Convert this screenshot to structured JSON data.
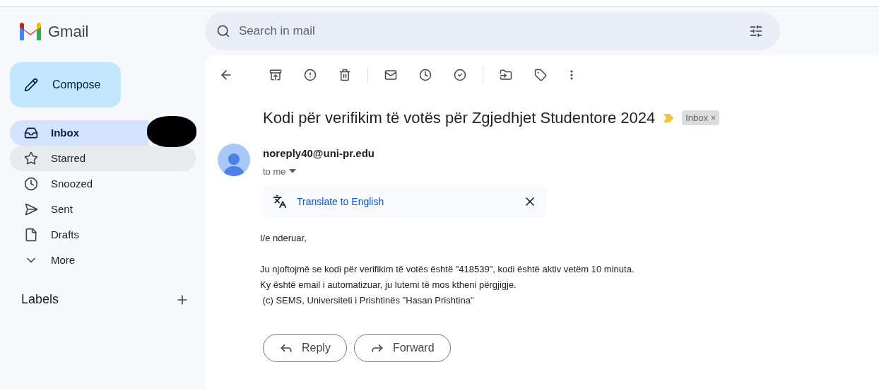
{
  "app": {
    "name": "Gmail"
  },
  "search": {
    "placeholder": "Search in mail"
  },
  "compose": {
    "label": "Compose"
  },
  "sidebar": {
    "items": [
      {
        "label": "Inbox",
        "selected": true,
        "hovered": false
      },
      {
        "label": "Starred",
        "selected": false,
        "hovered": true
      },
      {
        "label": "Snoozed",
        "selected": false,
        "hovered": false
      },
      {
        "label": "Sent",
        "selected": false,
        "hovered": false
      },
      {
        "label": "Drafts",
        "selected": false,
        "hovered": false
      },
      {
        "label": "More",
        "selected": false,
        "hovered": false
      }
    ],
    "labels_heading": "Labels"
  },
  "message": {
    "subject": "Kodi për verifikim të votës për Zgjedhjet Studentore 2024",
    "important": true,
    "label_chip": "Inbox",
    "label_chip_close": "×",
    "sender": "noreply40@uni-pr.edu",
    "recipient": "to me",
    "translate": "Translate to English",
    "body": [
      "I/e nderuar,",
      "Ju njoftojmë se kodi për verifikim të votës është \"418539\", kodi është aktiv vetëm 10 minuta.",
      "Ky është email i automatizuar, ju lutemi të mos ktheni përgjigje.",
      " (c) SEMS, Universiteti i Prishtinës \"Hasan Prishtina\""
    ],
    "actions": [
      {
        "kind": "reply",
        "label": "Reply"
      },
      {
        "kind": "forward",
        "label": "Forward"
      }
    ]
  }
}
